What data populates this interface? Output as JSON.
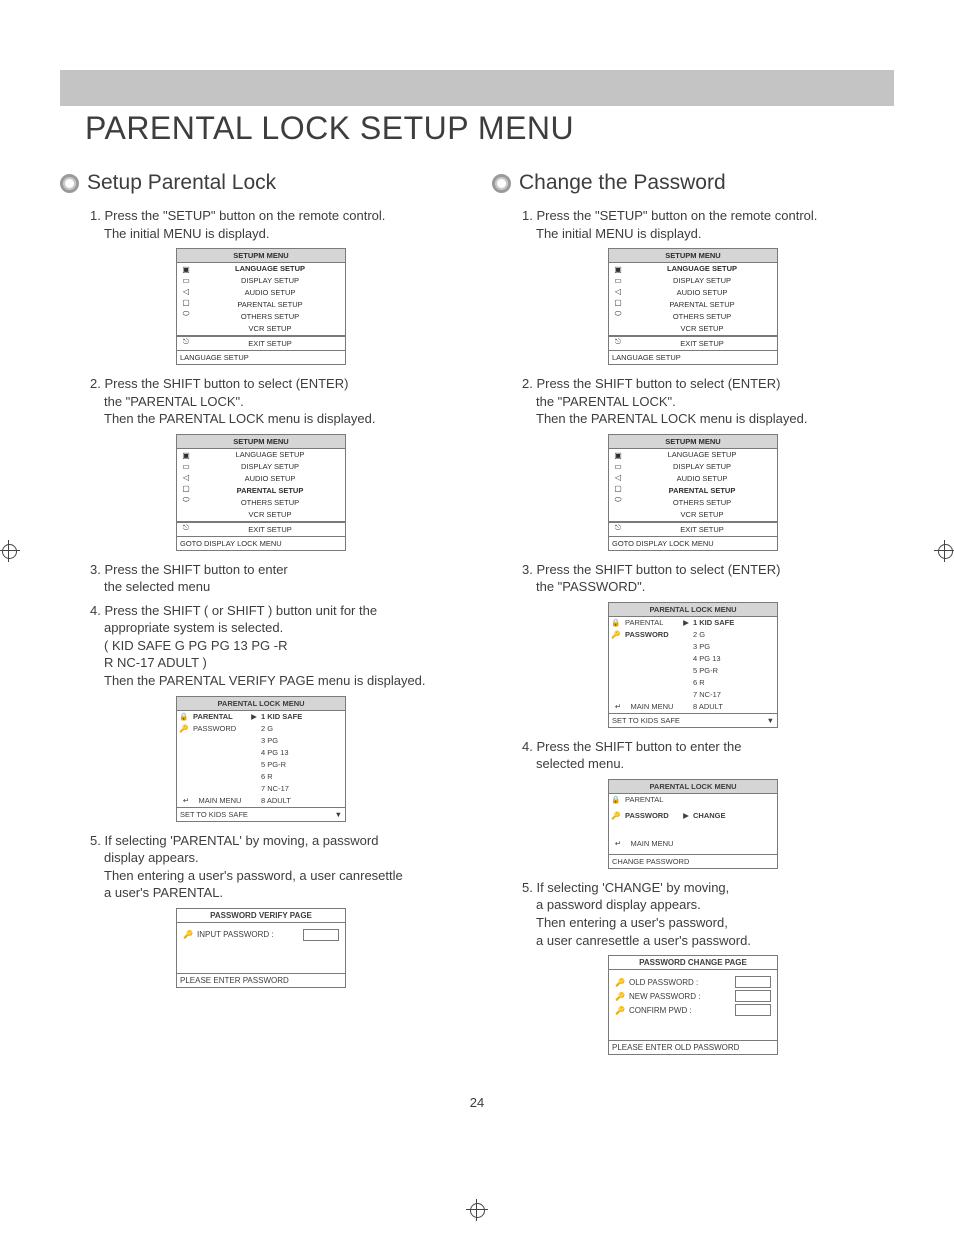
{
  "page_title": "PARENTAL LOCK SETUP MENU",
  "page_number": "24",
  "left": {
    "heading": "Setup Parental Lock",
    "steps": {
      "s1a": "1. Press the \"SETUP\" button on the remote control.",
      "s1b": "The initial MENU is displayd.",
      "s2a": "2. Press the SHIFT      button to select (ENTER)",
      "s2b": "the \"PARENTAL LOCK\".",
      "s2c": "Then the PARENTAL LOCK menu is displayed.",
      "s3a": "3. Press the SHIFT      button to enter",
      "s3b": "the selected menu",
      "s4a": "4. Press the SHIFT     ( or SHIFT     ) button unit for the",
      "s4b": "appropriate system is selected.",
      "s4c": "( KID SAFE    G    PG    PG 13    PG -R",
      "s4d": "R    NC-17    ADULT   )",
      "s4e": "Then the PARENTAL VERIFY PAGE menu is displayed.",
      "s5a": "5. If selecting 'PARENTAL' by moving,  a password",
      "s5b": "display appears.",
      "s5c": "Then entering a user's password, a user canresettle",
      "s5d": "a user's PARENTAL."
    }
  },
  "right": {
    "heading": "Change the Password",
    "steps": {
      "s1a": "1. Press the \"SETUP\" button on the remote control.",
      "s1b": "The initial MENU is displayd.",
      "s2a": "2. Press the SHIFT      button to select (ENTER)",
      "s2b": "the \"PARENTAL LOCK\".",
      "s2c": "Then the PARENTAL LOCK menu is displayed.",
      "s3a": "3. Press the SHIFT      button to select (ENTER)",
      "s3b": "the \"PASSWORD\".",
      "s4a": "4. Press the SHIFT      button to enter the",
      "s4b": "selected menu.",
      "s5a": "5. If selecting 'CHANGE' by moving,",
      "s5b": "a password display appears.",
      "s5c": "Then entering a user's password,",
      "s5d": "a user canresettle a user's password."
    }
  },
  "osd": {
    "setup_title": "SETUPM MENU",
    "rows": {
      "lang": "LANGUAGE SETUP",
      "disp": "DISPLAY SETUP",
      "audio": "AUDIO SETUP",
      "parental": "PARENTAL SETUP",
      "others": "OTHERS SETUP",
      "vcr": "VCR SETUP"
    },
    "exit": "EXIT SETUP",
    "foot_lang": "LANGUAGE SETUP",
    "foot_goto": "GOTO DISPLAY LOCK MENU"
  },
  "plock": {
    "title": "PARENTAL LOCK MENU",
    "left": {
      "parental": "PARENTAL",
      "password": "PASSWORD"
    },
    "arrow": "▶",
    "ratings": {
      "r1": "1 KID SAFE",
      "r2": "2 G",
      "r3": "3 PG",
      "r4": "4 PG 13",
      "r5": "5 PG-R",
      "r6": "6 R",
      "r7": "7 NC-17",
      "r8": "8 ADULT"
    },
    "main": "MAIN MENU",
    "foot": "SET TO KIDS SAFE",
    "change": "CHANGE",
    "foot_change": "CHANGE PASSWORD"
  },
  "pw_verify": {
    "title": "PASSWORD VERIFY PAGE",
    "label": "INPUT PASSWORD :",
    "foot": "PLEASE ENTER PASSWORD"
  },
  "pw_change": {
    "title": "PASSWORD CHANGE PAGE",
    "old": "OLD PASSWORD :",
    "new": "NEW PASSWORD :",
    "confirm": "CONFIRM PWD :",
    "foot": "PLEASE ENTER OLD PASSWORD"
  },
  "tiny_arrow": "▼"
}
